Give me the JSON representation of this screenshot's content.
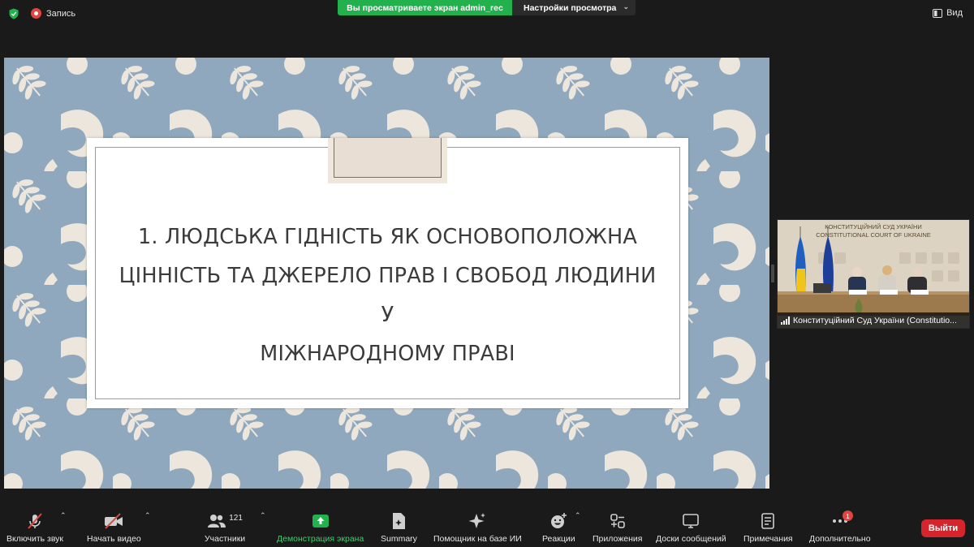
{
  "topbar": {
    "record_label": "Запись",
    "share_banner": "Вы просматриваете экран admin_rec",
    "view_settings": "Настройки просмотра",
    "view_label": "Вид"
  },
  "slide": {
    "title_lines": [
      "1. ЛЮДСЬКА ГІДНІСТЬ ЯК ОСНОВОПОЛОЖНА",
      "ЦІННІСТЬ ТА ДЖЕРЕЛО ПРАВ І СВОБОД ЛЮДИНИ У",
      "МІЖНАРОДНОМУ ПРАВІ"
    ]
  },
  "thumbnail": {
    "header_line1": "КОНСТИТУЦІЙНИЙ СУД УКРАЇНИ",
    "header_line2": "CONSTITUTIONAL COURT OF UKRAINE",
    "participant_name": "Конституційний Суд України (Constitutio..."
  },
  "toolbar": {
    "unmute": "Включить звук",
    "start_video": "Начать видео",
    "participants": "Участники",
    "participants_count": "121",
    "share_screen": "Демонстрация экрана",
    "summary": "Summary",
    "ai_assistant": "Помощник на базе ИИ",
    "reactions": "Реакции",
    "apps": "Приложения",
    "whiteboards": "Доски сообщений",
    "notes": "Примечания",
    "more": "Дополнительно",
    "more_badge": "1",
    "leave": "Выйти"
  },
  "colors": {
    "share_green": "#23b14d",
    "leave_red": "#d5242b",
    "slide_bg": "#8fa8bd",
    "pattern": "#ece6dc"
  }
}
